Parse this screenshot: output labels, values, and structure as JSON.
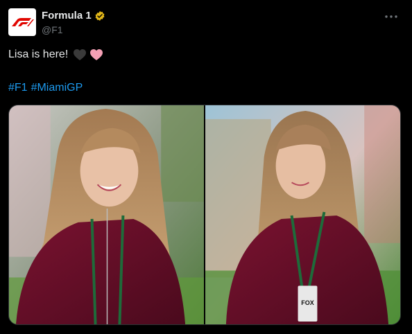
{
  "post": {
    "author": {
      "display_name": "Formula 1",
      "handle": "@F1",
      "verified_badge_color": "#e2b719",
      "avatar_icon": "f1-logo-icon",
      "avatar_color": "#e10600"
    },
    "text": "Lisa is here!",
    "emojis": [
      "black-heart-icon",
      "pink-heart-icon"
    ],
    "hashtags": [
      "#F1",
      "#MiamiGP"
    ],
    "more_icon": "more-options-icon",
    "media": [
      {
        "name": "photo-1"
      },
      {
        "name": "photo-2",
        "lanyard_badge": "FOX"
      }
    ]
  },
  "colors": {
    "link": "#1d9bf0",
    "text": "#e7e9ea",
    "muted": "#71767b",
    "background": "#000000"
  }
}
